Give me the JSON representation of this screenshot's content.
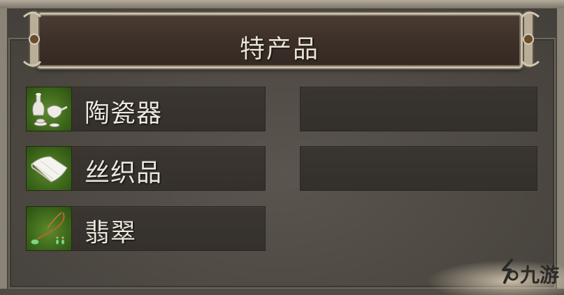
{
  "panel": {
    "title": "特产品"
  },
  "products": [
    {
      "label": "陶瓷器",
      "icon": "porcelain-icon"
    },
    {
      "label": "丝织品",
      "icon": "silk-icon"
    },
    {
      "label": "翡翠",
      "icon": "jade-necklace-icon"
    }
  ],
  "watermark": {
    "text": "九游"
  },
  "colors": {
    "banner": "#3d3029",
    "slot": "#38332e",
    "icon_bg": "#4a7a22",
    "text": "#ece7dc"
  }
}
